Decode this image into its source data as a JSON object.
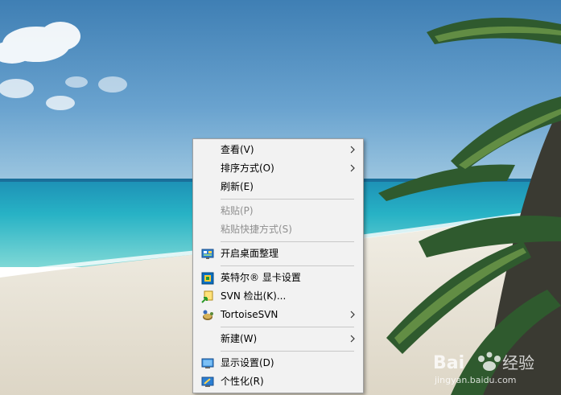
{
  "menu": {
    "view": {
      "label": "查看(V)",
      "disabled": false,
      "submenu": true
    },
    "sort": {
      "label": "排序方式(O)",
      "disabled": false,
      "submenu": true
    },
    "refresh": {
      "label": "刷新(E)",
      "disabled": false
    },
    "paste": {
      "label": "粘贴(P)",
      "disabled": true
    },
    "paste_shortcut": {
      "label": "粘贴快捷方式(S)",
      "disabled": true
    },
    "defrag": {
      "label": "开启桌面整理",
      "icon": "monitor-icon"
    },
    "intel": {
      "label": "英特尔® 显卡设置",
      "icon": "intel-graphics-icon"
    },
    "svn_checkout": {
      "label": "SVN 检出(K)...",
      "icon": "svn-checkout-icon"
    },
    "tortoise": {
      "label": "TortoiseSVN",
      "icon": "tortoise-icon",
      "submenu": true
    },
    "new": {
      "label": "新建(W)",
      "submenu": true
    },
    "display": {
      "label": "显示设置(D)",
      "icon": "display-icon"
    },
    "personalize": {
      "label": "个性化(R)",
      "icon": "personalize-icon"
    }
  },
  "watermark": {
    "url": "jingyan.baidu.com"
  },
  "colors": {
    "menu_bg": "#f2f2f2",
    "disabled_text": "#8f8f8f",
    "sky": "#4f8fc0",
    "sea": "#2fb6c6"
  }
}
